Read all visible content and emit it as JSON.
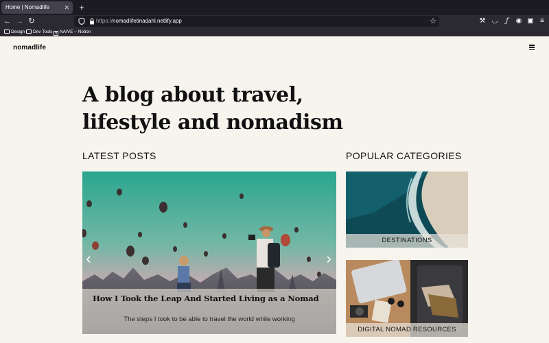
{
  "browser": {
    "tab_title": "Home | Nomadlife",
    "url_prefix": "https://",
    "url_host": "nomadlifetinadahl.netlify.app",
    "bookmarks": [
      "Design",
      "Dev Tools",
      "NAIVE – Notion"
    ]
  },
  "site": {
    "logo": "nomadlife",
    "hero_line1": "A blog about travel,",
    "hero_line2": "lifestyle and nomadism"
  },
  "latest_posts": {
    "heading": "LATEST POSTS",
    "featured": {
      "title": "How I Took the Leap And Started Living as a Nomad",
      "subtitle": "The steps I took to be able to travel the world while working"
    }
  },
  "popular_categories": {
    "heading": "POPULAR CATEGORIES",
    "items": [
      {
        "label": "DESTINATIONS"
      },
      {
        "label": "DIGITAL NOMAD RESOURCES"
      }
    ]
  },
  "icons": [
    "shield-icon",
    "lock-icon",
    "star-icon",
    "wrench-icon",
    "pocket-icon",
    "function-icon",
    "extension-icon",
    "notion-icon",
    "menu-icon",
    "hamburger-icon",
    "chevron-left-icon",
    "chevron-right-icon"
  ],
  "colors": {
    "page_bg": "#f7f4ee",
    "browser_dark": "#1c1b22",
    "browser_toolbar": "#2b2a33",
    "text": "#111111"
  }
}
